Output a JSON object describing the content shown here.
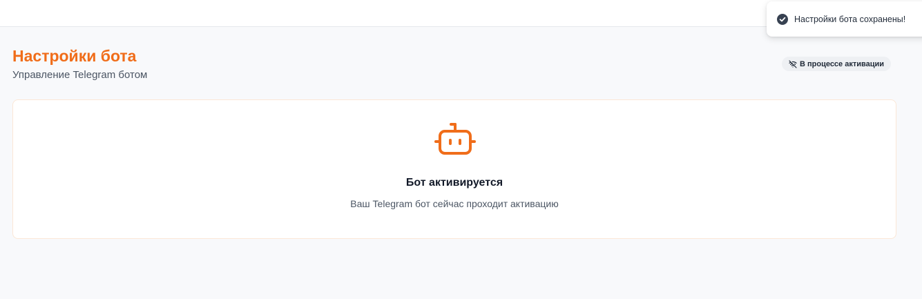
{
  "header": {
    "title": "Настройки бота",
    "subtitle": "Управление Telegram ботом"
  },
  "status": {
    "label": "В процессе активации",
    "icon": "wifi-off-icon"
  },
  "card": {
    "icon": "robot-icon",
    "title": "Бот активируется",
    "text": "Ваш Telegram бот сейчас проходит активацию"
  },
  "toast": {
    "icon": "check-circle-icon",
    "message": "Настройки бота сохранены!"
  },
  "colors": {
    "accent": "#f06d1a",
    "background": "#f8f9fb",
    "text": "#111827",
    "muted": "#4b5563",
    "toast_icon": "#374151"
  }
}
